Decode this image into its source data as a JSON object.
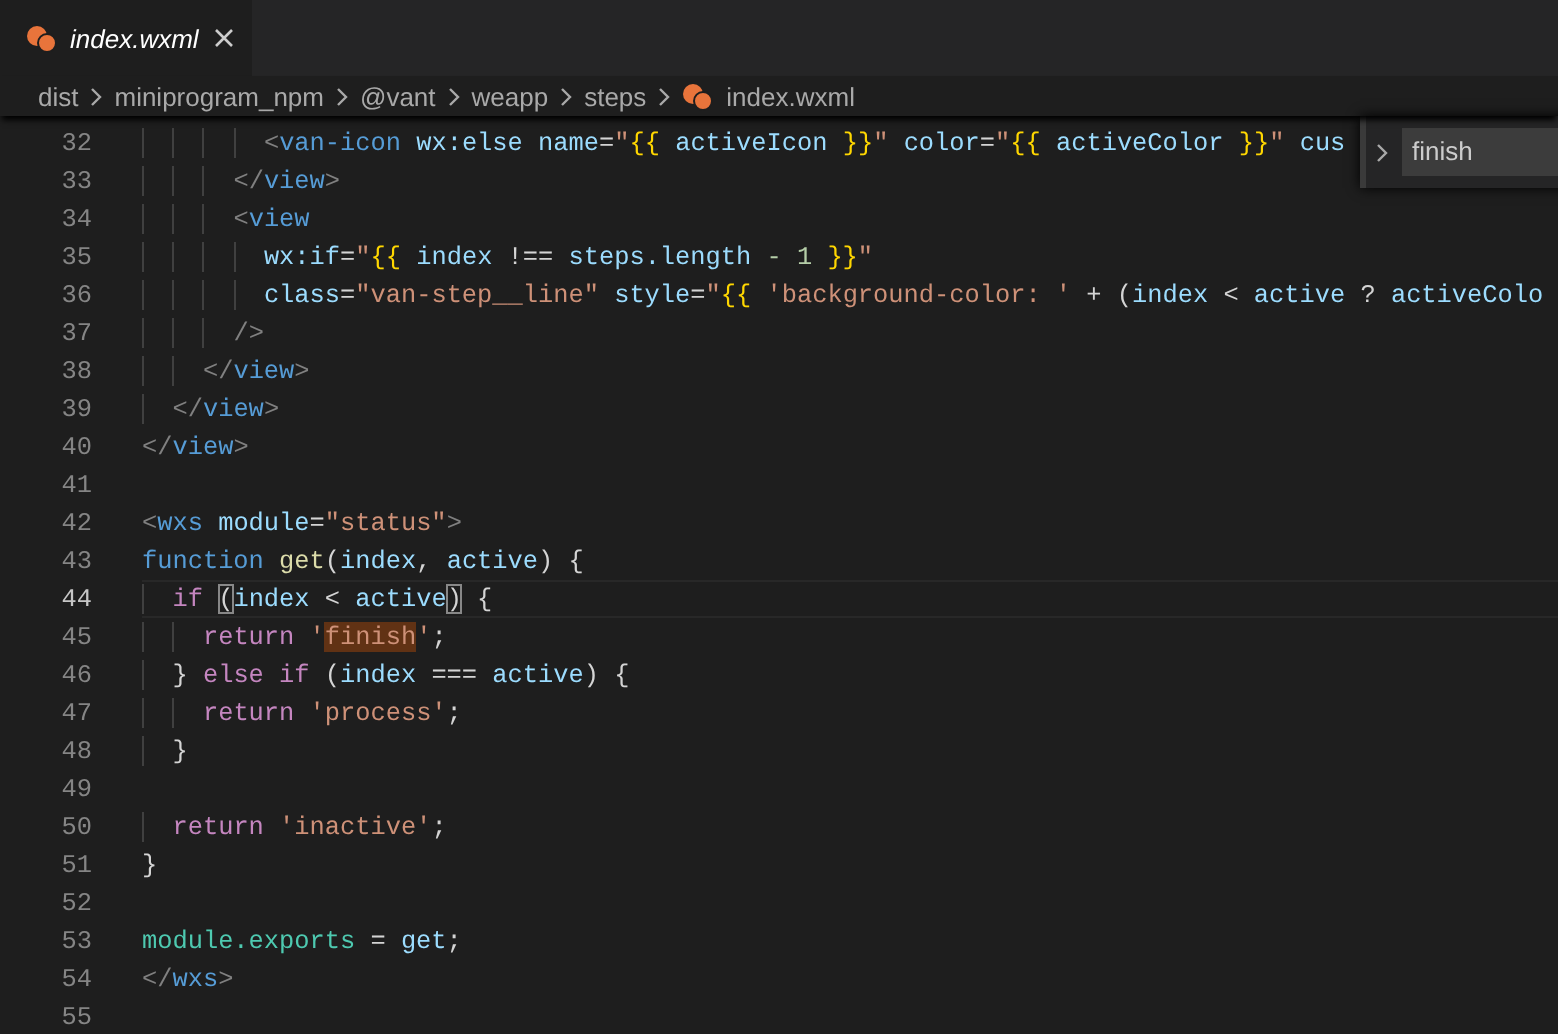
{
  "tabs": [
    {
      "label": "index.wxml",
      "selected": true
    }
  ],
  "breadcrumb": [
    {
      "label": "dist",
      "kind": "folder"
    },
    {
      "label": "miniprogram_npm",
      "kind": "folder"
    },
    {
      "label": "@vant",
      "kind": "folder"
    },
    {
      "label": "weapp",
      "kind": "folder"
    },
    {
      "label": "steps",
      "kind": "folder"
    },
    {
      "label": "index.wxml",
      "kind": "file"
    }
  ],
  "find_widget": {
    "value": "finish"
  },
  "lines": [
    {
      "number": "32",
      "current": false,
      "tokens": [
        {
          "text": "        <",
          "kind": "p"
        },
        {
          "text": "van-icon",
          "kind": "t"
        },
        {
          "text": " wx:else",
          "kind": "a"
        },
        {
          "text": " name",
          "kind": "a"
        },
        {
          "text": "=",
          "kind": "o"
        },
        {
          "text": "\"",
          "kind": "s"
        },
        {
          "text": "{{",
          "kind": "b"
        },
        {
          "text": " activeIcon ",
          "kind": "v"
        },
        {
          "text": "}}",
          "kind": "b"
        },
        {
          "text": "\"",
          "kind": "s"
        },
        {
          "text": " color",
          "kind": "a"
        },
        {
          "text": "=",
          "kind": "o"
        },
        {
          "text": "\"",
          "kind": "s"
        },
        {
          "text": "{{",
          "kind": "b"
        },
        {
          "text": " activeColor ",
          "kind": "v"
        },
        {
          "text": "}}",
          "kind": "b"
        },
        {
          "text": "\"",
          "kind": "s"
        },
        {
          "text": " cus",
          "kind": "a"
        }
      ]
    },
    {
      "number": "33",
      "current": false,
      "tokens": [
        {
          "text": "      </",
          "kind": "p"
        },
        {
          "text": "view",
          "kind": "t"
        },
        {
          "text": ">",
          "kind": "p"
        }
      ]
    },
    {
      "number": "34",
      "current": false,
      "tokens": [
        {
          "text": "      <",
          "kind": "p"
        },
        {
          "text": "view",
          "kind": "t"
        }
      ]
    },
    {
      "number": "35",
      "current": false,
      "tokens": [
        {
          "text": "        wx:if",
          "kind": "a"
        },
        {
          "text": "=",
          "kind": "o"
        },
        {
          "text": "\"",
          "kind": "s"
        },
        {
          "text": "{{",
          "kind": "b"
        },
        {
          "text": " index ",
          "kind": "v"
        },
        {
          "text": "!==",
          "kind": "o"
        },
        {
          "text": " steps.length ",
          "kind": "v"
        },
        {
          "text": "- 1",
          "kind": "n"
        },
        {
          "text": " }}",
          "kind": "b"
        },
        {
          "text": "\"",
          "kind": "s"
        }
      ]
    },
    {
      "number": "36",
      "current": false,
      "tokens": [
        {
          "text": "        class",
          "kind": "a"
        },
        {
          "text": "=",
          "kind": "o"
        },
        {
          "text": "\"van-step__line\"",
          "kind": "s"
        },
        {
          "text": " style",
          "kind": "a"
        },
        {
          "text": "=",
          "kind": "o"
        },
        {
          "text": "\"",
          "kind": "s"
        },
        {
          "text": "{{",
          "kind": "b"
        },
        {
          "text": " 'background-color: '",
          "kind": "s"
        },
        {
          "text": " + (",
          "kind": "o"
        },
        {
          "text": "index",
          "kind": "v"
        },
        {
          "text": " < ",
          "kind": "o"
        },
        {
          "text": "active",
          "kind": "v"
        },
        {
          "text": " ? ",
          "kind": "o"
        },
        {
          "text": "activeColo",
          "kind": "v"
        }
      ]
    },
    {
      "number": "37",
      "current": false,
      "tokens": [
        {
          "text": "      />",
          "kind": "p"
        }
      ]
    },
    {
      "number": "38",
      "current": false,
      "tokens": [
        {
          "text": "    </",
          "kind": "p"
        },
        {
          "text": "view",
          "kind": "t"
        },
        {
          "text": ">",
          "kind": "p"
        }
      ]
    },
    {
      "number": "39",
      "current": false,
      "tokens": [
        {
          "text": "  </",
          "kind": "p"
        },
        {
          "text": "view",
          "kind": "t"
        },
        {
          "text": ">",
          "kind": "p"
        }
      ]
    },
    {
      "number": "40",
      "current": false,
      "tokens": [
        {
          "text": "</",
          "kind": "p"
        },
        {
          "text": "view",
          "kind": "t"
        },
        {
          "text": ">",
          "kind": "p"
        }
      ]
    },
    {
      "number": "41",
      "current": false
    },
    {
      "number": "42",
      "current": false,
      "tokens": [
        {
          "text": "<",
          "kind": "p"
        },
        {
          "text": "wxs",
          "kind": "t"
        },
        {
          "text": " module",
          "kind": "a"
        },
        {
          "text": "=",
          "kind": "o"
        },
        {
          "text": "\"status\"",
          "kind": "s"
        },
        {
          "text": ">",
          "kind": "p"
        }
      ]
    },
    {
      "number": "43",
      "current": false,
      "tokens": [
        {
          "text": "function",
          "kind": "sk"
        },
        {
          "text": " get",
          "kind": "f"
        },
        {
          "text": "(",
          "kind": "o"
        },
        {
          "text": "index",
          "kind": "v"
        },
        {
          "text": ", ",
          "kind": "o"
        },
        {
          "text": "active",
          "kind": "v"
        },
        {
          "text": ") {",
          "kind": "o"
        }
      ]
    },
    {
      "number": "44",
      "current": true,
      "tokens": [
        {
          "text": "  if ",
          "kind": "k"
        },
        {
          "text": "(",
          "kind": "o",
          "bracket_match": true
        },
        {
          "text": "index",
          "kind": "v"
        },
        {
          "text": " < ",
          "kind": "o"
        },
        {
          "text": "active",
          "kind": "v"
        },
        {
          "text": ")",
          "kind": "o",
          "bracket_match": true
        },
        {
          "text": " {",
          "kind": "o"
        }
      ]
    },
    {
      "number": "45",
      "current": false,
      "tokens": [
        {
          "text": "    return",
          "kind": "k"
        },
        {
          "text": " '",
          "kind": "s"
        },
        {
          "text": "finish",
          "kind": "s",
          "find_match": true
        },
        {
          "text": "'",
          "kind": "s"
        },
        {
          "text": ";",
          "kind": "o"
        }
      ]
    },
    {
      "number": "46",
      "current": false,
      "tokens": [
        {
          "text": "  } ",
          "kind": "o"
        },
        {
          "text": "else if",
          "kind": "k"
        },
        {
          "text": " (",
          "kind": "o"
        },
        {
          "text": "index",
          "kind": "v"
        },
        {
          "text": " === ",
          "kind": "o"
        },
        {
          "text": "active",
          "kind": "v"
        },
        {
          "text": ") {",
          "kind": "o"
        }
      ]
    },
    {
      "number": "47",
      "current": false,
      "tokens": [
        {
          "text": "    return",
          "kind": "k"
        },
        {
          "text": " 'process'",
          "kind": "s"
        },
        {
          "text": ";",
          "kind": "o"
        }
      ]
    },
    {
      "number": "48",
      "current": false,
      "tokens": [
        {
          "text": "  }",
          "kind": "o"
        }
      ]
    },
    {
      "number": "49",
      "current": false
    },
    {
      "number": "50",
      "current": false,
      "tokens": [
        {
          "text": "  return",
          "kind": "k"
        },
        {
          "text": " 'inactive'",
          "kind": "s"
        },
        {
          "text": ";",
          "kind": "o"
        }
      ]
    },
    {
      "number": "51",
      "current": false,
      "tokens": [
        {
          "text": "}",
          "kind": "o"
        }
      ]
    },
    {
      "number": "52",
      "current": false
    },
    {
      "number": "53",
      "current": false,
      "tokens": [
        {
          "text": "module.exports",
          "kind": "c"
        },
        {
          "text": " = ",
          "kind": "o"
        },
        {
          "text": "get",
          "kind": "v"
        },
        {
          "text": ";",
          "kind": "o"
        }
      ]
    },
    {
      "number": "54",
      "current": false,
      "tokens": [
        {
          "text": "</",
          "kind": "p"
        },
        {
          "text": "wxs",
          "kind": "t"
        },
        {
          "text": ">",
          "kind": "p"
        }
      ]
    },
    {
      "number": "55",
      "current": false
    }
  ]
}
